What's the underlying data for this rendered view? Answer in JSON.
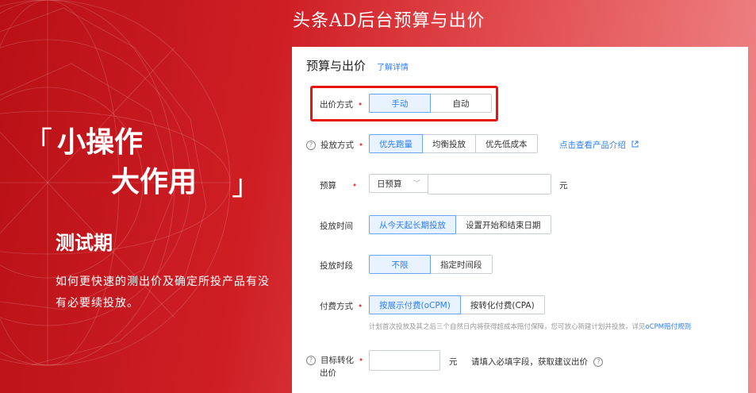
{
  "banner": {
    "title": "头条AD后台预算与出价",
    "slogan_open": "「",
    "slogan_line1": "小操作",
    "slogan_line2": "大作用",
    "slogan_close": "」",
    "phase": "测试期",
    "description": "如何更快速的测出价及确定所投产品有没有必要续投放。"
  },
  "panel": {
    "title": "预算与出价",
    "learn_more": "了解详情",
    "bid_method": {
      "label": "出价方式",
      "required": "•",
      "options": [
        "手动",
        "自动"
      ],
      "selected": "手动"
    },
    "delivery_method": {
      "label": "投放方式",
      "required": "•",
      "options": [
        "优先跑量",
        "均衡投放",
        "优先低成本"
      ],
      "selected": "优先跑量",
      "link": "点击查看产品介绍",
      "link_icon": "external-link-icon"
    },
    "budget": {
      "label": "预算",
      "required": "•",
      "select_value": "日预算",
      "input_value": "",
      "unit": "元"
    },
    "delivery_time": {
      "label": "投放时间",
      "options": [
        "从今天起长期投放",
        "设置开始和结束日期"
      ],
      "selected": "从今天起长期投放"
    },
    "time_slot": {
      "label": "投放时段",
      "options": [
        "不限",
        "指定时间段"
      ],
      "selected": "不限"
    },
    "payment": {
      "label": "付费方式",
      "required": "•",
      "options": [
        "按展示付费(oCPM)",
        "按转化付费(CPA)"
      ],
      "selected": "按展示付费(oCPM)",
      "note": "计划首次投放及其之后三个自然日内将获得超成本赔付保障，您可放心新建计划并投放，详见",
      "note_link": "oCPM赔付规则"
    },
    "target_bid": {
      "label_line1": "目标转化",
      "label_line2": "出价",
      "required": "•",
      "input_value": "",
      "unit": "元",
      "hint": "请填入必填字段，获取建议出价"
    }
  },
  "colors": {
    "brand_red": "#cf1f25",
    "accent_blue": "#2d7ff9",
    "highlight_box": "#e8140e"
  }
}
